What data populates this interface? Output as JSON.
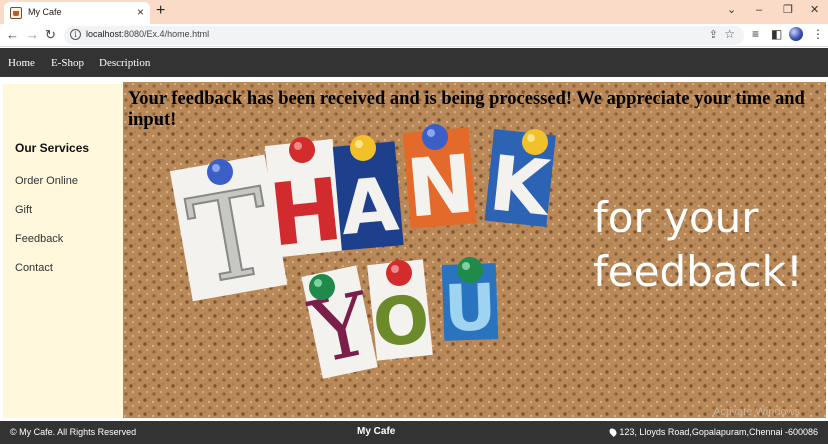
{
  "browser": {
    "tab_title": "My Cafe",
    "tab_close": "×",
    "new_tab": "+",
    "window_controls": {
      "dropdown": "⌄",
      "minimize": "–",
      "restore": "❐",
      "close": "✕"
    },
    "url_host": "localhost",
    "url_rest": ":8080/Ex.4/home.html",
    "nav_icons": {
      "back": "←",
      "forward": "→",
      "reload": "↻",
      "info": "i",
      "share": "⇪",
      "bookmark": "☆",
      "media": "≡",
      "sidepanel": "◧",
      "menu": "⋮"
    }
  },
  "nav": {
    "items": [
      {
        "label": "Home"
      },
      {
        "label": "E-Shop"
      },
      {
        "label": "Description"
      }
    ]
  },
  "sidebar": {
    "title": "Our Services",
    "items": [
      {
        "label": "Order Online"
      },
      {
        "label": "Gift"
      },
      {
        "label": "Feedback"
      },
      {
        "label": "Contact"
      }
    ]
  },
  "main": {
    "heading": "Your feedback has been received and is being processed! We appreciate your time and input!",
    "image": {
      "letters_top": [
        "T",
        "H",
        "A",
        "N",
        "K"
      ],
      "letters_bottom": [
        "Y",
        "O",
        "U"
      ],
      "caption_line1": "for your",
      "caption_line2": "feedback!",
      "watermark": "Activate Windows"
    }
  },
  "footer": {
    "copyright": "© My Cafe. All Rights Reserved",
    "brand": "My Cafe",
    "address": "123, Lloyds Road,Gopalapuram,Chennai -600086"
  },
  "colors": {
    "nav_bg": "#333333",
    "sidebar_bg": "#fff8dc",
    "cork": "#b88a57",
    "tabstrip": "#fadbc8"
  }
}
